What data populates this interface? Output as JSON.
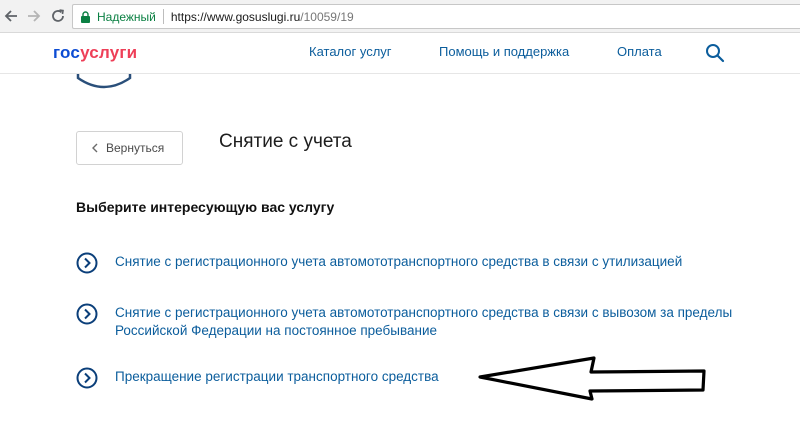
{
  "browser": {
    "secure_label": "Надежный",
    "url_host": "https://www.gosuslugi.ru",
    "url_path": "/10059/19",
    "icons": [
      "back-icon",
      "forward-icon",
      "reload-icon",
      "lock-icon"
    ]
  },
  "header": {
    "logo_part1": "гос",
    "logo_part2": "услуги",
    "nav": {
      "catalog": "Каталог услуг",
      "help": "Помощь и поддержка",
      "pay": "Оплата"
    },
    "search_icon": "search-icon"
  },
  "page": {
    "back_label": "Вернуться",
    "title": "Снятие с учета",
    "section_heading": "Выберите интересующую вас услугу",
    "services": [
      {
        "label": "Снятие с регистрационного учета автомототранспортного средства в связи с утилизацией"
      },
      {
        "label": "Снятие с регистрационного учета автомототранспортного средства в связи с вывозом за пределы Российской Федерации на постоянное пребывание"
      },
      {
        "label": "Прекращение регистрации транспортного средства"
      }
    ]
  },
  "colors": {
    "link": "#0b5d9c",
    "logo_blue": "#0d4cd3",
    "logo_red": "#ee3f58",
    "secure_green": "#0b8043"
  }
}
